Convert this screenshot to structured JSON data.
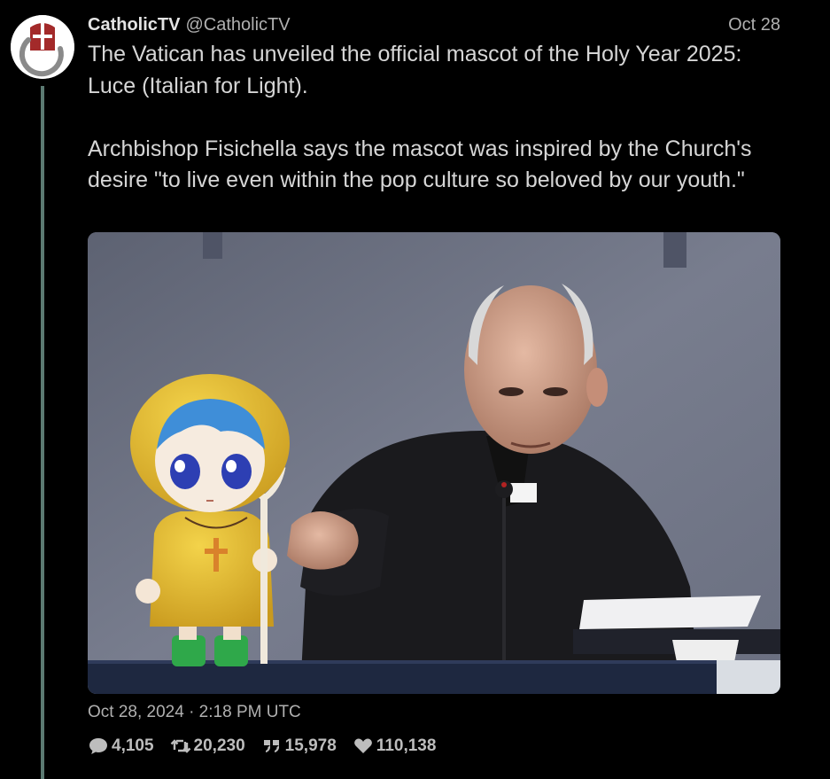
{
  "tweet": {
    "display_name": "CatholicTV",
    "handle": "@CatholicTV",
    "date_short": "Oct 28",
    "text_paragraph_1": "The Vatican has unveiled the official mascot of the Holy Year 2025: Luce (Italian for Light).",
    "text_paragraph_2": "Archbishop Fisichella says the mascot was inspired by the Church's desire \"to live even within the pop culture so beloved by our youth.\"",
    "timestamp": "Oct 28, 2024 · 2:18 PM UTC"
  },
  "stats": {
    "replies": "4,105",
    "retweets": "20,230",
    "quotes": "15,978",
    "likes": "110,138"
  },
  "icons": {
    "reply": "comment-icon",
    "retweet": "retweet-icon",
    "quote": "quote-icon",
    "like": "heart-icon"
  },
  "colors": {
    "background": "#000000",
    "thread_line": "#5b7a72",
    "text": "#d6d6d6",
    "muted": "#b0b0b0",
    "avatar_red": "#a32a2a"
  }
}
